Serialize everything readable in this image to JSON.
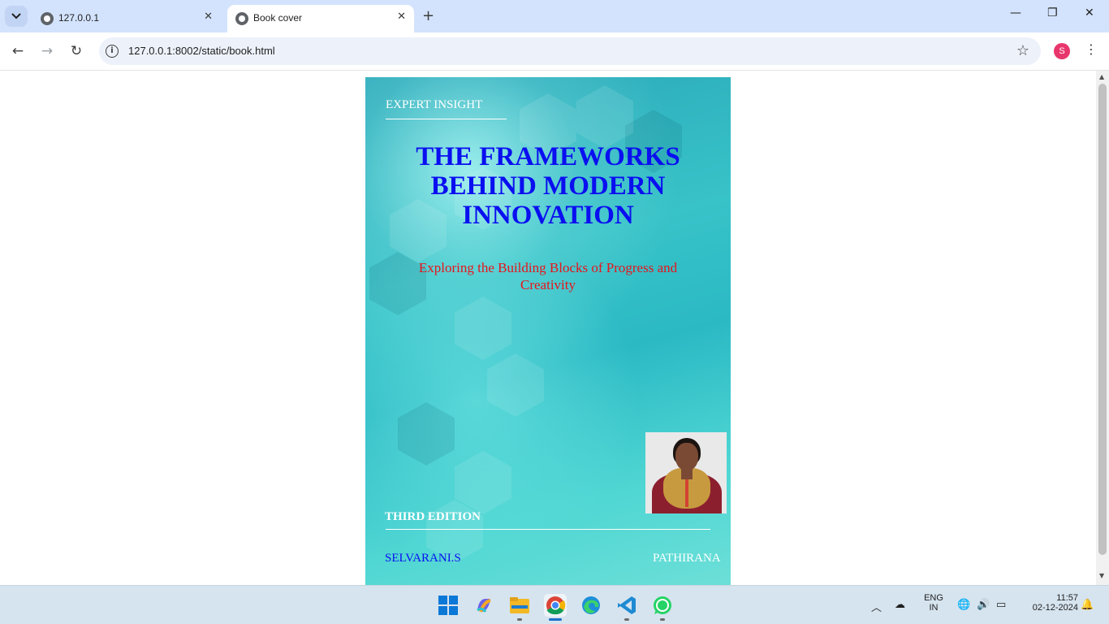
{
  "browser": {
    "tabs": [
      {
        "title": "127.0.0.1",
        "active": false
      },
      {
        "title": "Book cover",
        "active": true
      }
    ],
    "url": "127.0.0.1:8002/static/book.html",
    "profile_initial": "S"
  },
  "cover": {
    "top_label": "EXPERT INSIGHT",
    "title": "THE FRAMEWORKS BEHIND MODERN INNOVATION",
    "subtitle": "Exploring the Building Blocks of Progress and Creativity",
    "edition": "THIRD EDITION",
    "author_left": "SELVARANI.S",
    "author_right": "PATHIRANA",
    "title_color": "#0a0ff0",
    "subtitle_color": "#e8141b"
  },
  "taskbar": {
    "apps": [
      "windows-start",
      "copilot",
      "file-explorer",
      "chrome",
      "edge",
      "vscode",
      "whatsapp"
    ],
    "language_line1": "ENG",
    "language_line2": "IN",
    "time": "11:57",
    "date": "02-12-2024"
  }
}
